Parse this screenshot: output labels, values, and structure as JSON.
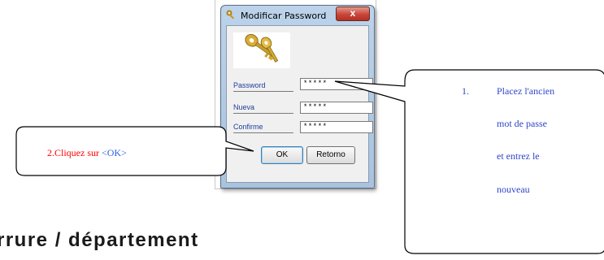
{
  "dialog": {
    "title": "Modificar Password",
    "close_label": "x",
    "fields": [
      {
        "label": "Password",
        "value": "*****"
      },
      {
        "label": "Nueva",
        "value": "*****"
      },
      {
        "label": "Confirme",
        "value": "*****"
      }
    ],
    "ok_label": "OK",
    "retorno_label": "Retorno"
  },
  "callout_left": {
    "text_prefix": "2.Cliquez sur ",
    "text_ok": "<OK>"
  },
  "callout_right": {
    "number": "1.",
    "lines": [
      "Placez l'ancien",
      "mot de passe",
      "et entrez le",
      "nouveau"
    ]
  },
  "heading": "rrure / département",
  "colors": {
    "callout_left_text": "#ff0000",
    "callout_ok_text": "#2f5de6",
    "callout_right_text": "#2f45c8",
    "field_label": "#1d3f9a"
  }
}
